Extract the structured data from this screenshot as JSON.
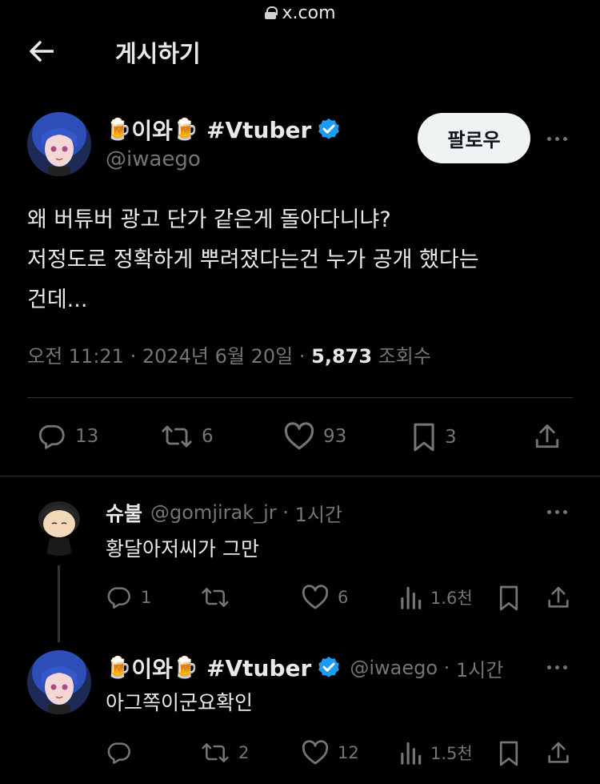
{
  "url_bar": {
    "domain": "x.com"
  },
  "header": {
    "title": "게시하기"
  },
  "main_post": {
    "display_name": "이와",
    "display_suffix": "#Vtuber",
    "handle": "@iwaego",
    "follow_label": "팔로우",
    "text_lines": [
      "왜 버튜버 광고 단가 같은게 돌아다니냐?",
      "저정도로 정확하게 뿌려졌다는건 누가 공개 했다는",
      "건데..."
    ],
    "time": "오전 11:21",
    "date": "2024년 6월 20일",
    "views": "5,873",
    "views_label": "조회수",
    "stats": {
      "replies": "13",
      "reposts": "6",
      "likes": "93",
      "bookmarks": "3"
    }
  },
  "replies": [
    {
      "display_name": "슈불",
      "handle": "@gomjirak_jr",
      "time": "1시간",
      "text": "황달아저씨가 그만",
      "stats": {
        "replies": "1",
        "reposts": "",
        "likes": "6",
        "views": "1.6천"
      }
    },
    {
      "display_name": "이와",
      "display_suffix": "#Vtuber",
      "handle": "@iwaego",
      "time": "1시간",
      "text": "아그쪽이군요확인",
      "stats": {
        "replies": "",
        "reposts": "2",
        "likes": "12",
        "views": "1.5천"
      }
    }
  ],
  "colors": {
    "background": "#000000",
    "text": "#e7e9ea",
    "muted": "#71767b",
    "verified": "#1d9bf0",
    "divider": "#2f3336"
  }
}
